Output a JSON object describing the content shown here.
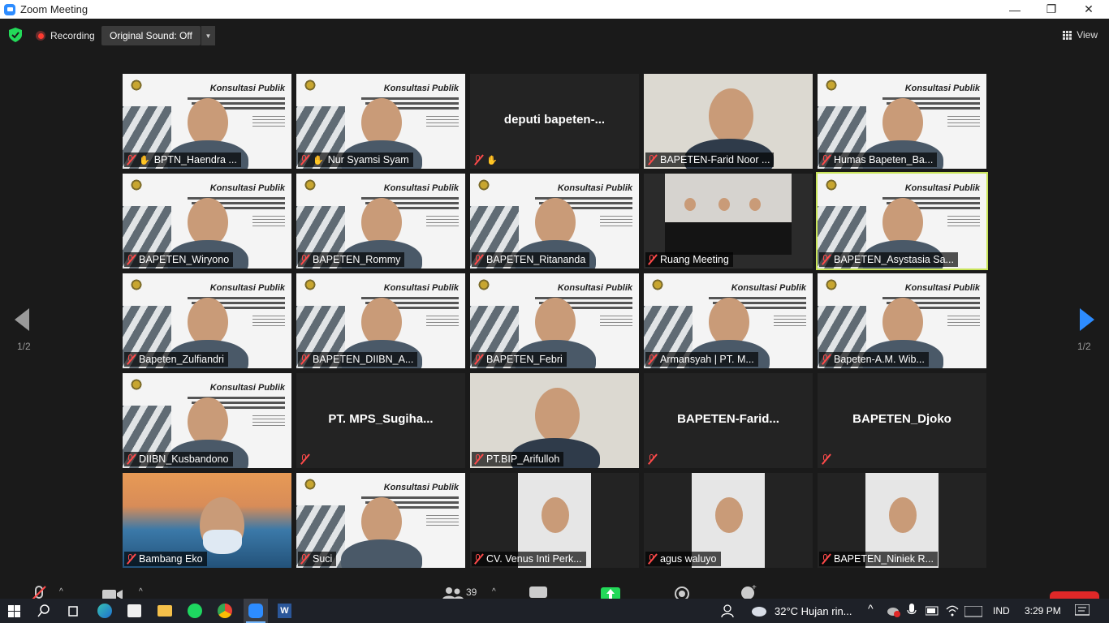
{
  "window": {
    "title": "Zoom Meeting",
    "minimize": "—",
    "restore": "❐",
    "close": "✕"
  },
  "topbar": {
    "recording": "Recording",
    "original_sound": "Original Sound: Off",
    "view": "View"
  },
  "pager": {
    "left": "1/2",
    "right": "1/2"
  },
  "tiles": [
    {
      "name": "BPTN_Haendra ...",
      "kind": "slide",
      "hand": true
    },
    {
      "name": "Nur Syamsi Syam",
      "kind": "slide",
      "hand": true
    },
    {
      "name": "deputi_bapeten-...",
      "kind": "name",
      "big": "deputi  bapeten-...",
      "hand": true
    },
    {
      "name": "BAPETEN-Farid Noor ...",
      "kind": "video"
    },
    {
      "name": "Humas Bapeten_Ba...",
      "kind": "slide"
    },
    {
      "name": "BAPETEN_Wiryono",
      "kind": "slide"
    },
    {
      "name": "BAPETEN_Rommy",
      "kind": "slide"
    },
    {
      "name": "BAPETEN_Ritananda",
      "kind": "slide"
    },
    {
      "name": "Ruang Meeting",
      "kind": "room"
    },
    {
      "name": "BAPETEN_Asystasia Sa...",
      "kind": "slide",
      "active": true
    },
    {
      "name": "Bapeten_Zulfiandri",
      "kind": "slide"
    },
    {
      "name": "BAPETEN_DIIBN_A...",
      "kind": "slide"
    },
    {
      "name": "BAPETEN_Febri",
      "kind": "slide"
    },
    {
      "name": "Armansyah | PT. M...",
      "kind": "slide"
    },
    {
      "name": "Bapeten-A.M. Wib...",
      "kind": "slide"
    },
    {
      "name": "DIIBN_Kusbandono",
      "kind": "slide"
    },
    {
      "name": "PT. MPS_Sugiha...",
      "kind": "name",
      "big": "PT.  MPS_Sugiha..."
    },
    {
      "name": "PT.BIP_Arifulloh",
      "kind": "video"
    },
    {
      "name": "BAPETEN-Farid...",
      "kind": "name",
      "big": "BAPETEN-Farid..."
    },
    {
      "name": "BAPETEN_Djoko",
      "kind": "name",
      "big": "BAPETEN_Djoko"
    },
    {
      "name": "Bambang Eko",
      "kind": "bridge"
    },
    {
      "name": "Suci",
      "kind": "slide"
    },
    {
      "name": "CV. Venus Inti Perk...",
      "kind": "pillar"
    },
    {
      "name": "agus waluyo",
      "kind": "pillar"
    },
    {
      "name": "BAPETEN_Niniek R...",
      "kind": "pillar"
    }
  ],
  "slide": {
    "title": "Konsultasi Publik"
  },
  "bottom": {
    "participants_count": "39"
  },
  "taskbar": {
    "weather": "32°C  Hujan rin...",
    "lang": "IND",
    "time": "3:29 PM"
  },
  "colors": {
    "active_speaker": "#c9e45a",
    "share": "#23d959",
    "accent": "#2d8cff"
  }
}
